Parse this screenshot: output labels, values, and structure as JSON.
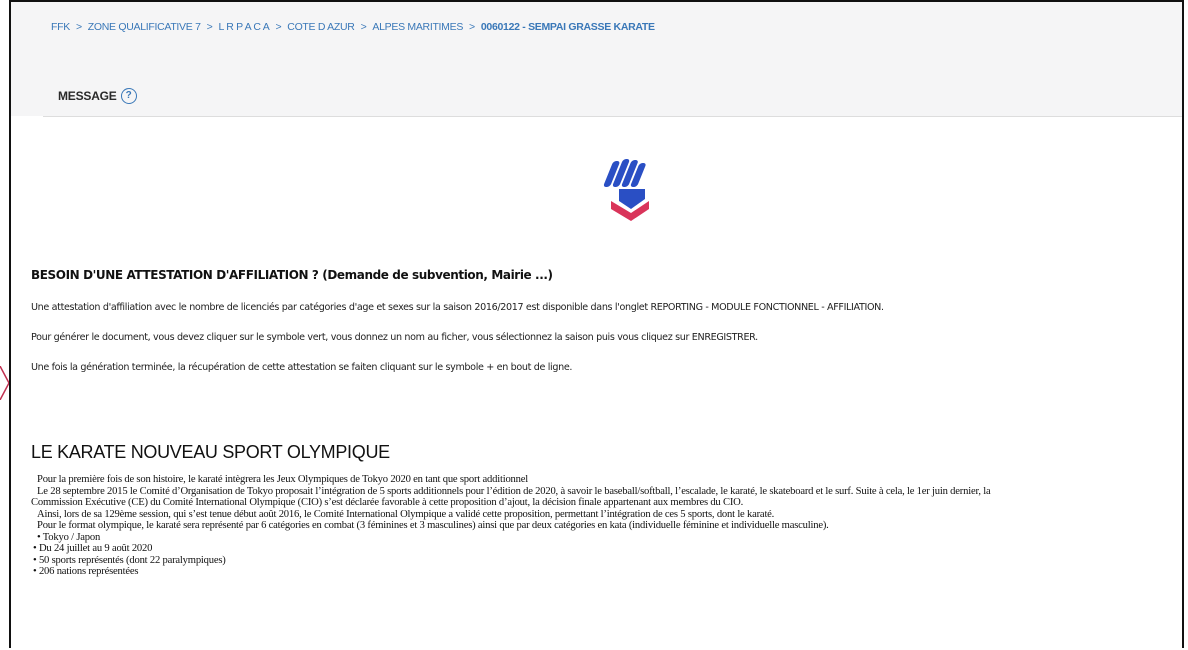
{
  "breadcrumb": {
    "items": [
      "FFK",
      "ZONE QUALIFICATIVE 7",
      "L R P A C A",
      "COTE D AZUR",
      "ALPES MARITIMES"
    ],
    "current": "0060122 - SEMPAI GRASSE KARATE",
    "separator": ">"
  },
  "message": {
    "title": "MESSAGE",
    "help_glyph": "?"
  },
  "logo": {
    "icon": "ffk-fist-logo-icon",
    "colors": {
      "blue": "#2a4fc4",
      "red": "#d9345a"
    }
  },
  "affiliation": {
    "title": "BESOIN D'UNE ATTESTATION D'AFFILIATION ? (Demande de subvention, Mairie ...)",
    "paragraphs": [
      "Une attestation d'affiliation avec le nombre de licenciés par catégories d'age et sexes sur la saison 2016/2017 est disponible dans l'onglet REPORTING - MODULE FONCTIONNEL - AFFILIATION.",
      "Pour générer le document, vous devez cliquer sur le symbole vert, vous donnez un nom au ficher, vous sélectionnez la saison puis vous cliquez sur ENREGISTRER.",
      "Une fois la génération terminée, la récupération de cette attestation se faiten cliquant sur le symbole + en bout de ligne."
    ]
  },
  "olympic": {
    "title": "LE KARATE NOUVEAU SPORT OLYMPIQUE",
    "lines": [
      "Pour la première fois de son histoire, le karaté intègrera les Jeux Olympiques de Tokyo 2020 en tant que sport additionnel",
      "Le 28 septembre 2015 le Comité d’Organisation de Tokyo proposait l’intégration de 5 sports additionnels pour l’édition de 2020, à savoir le baseball/softball, l’escalade, le karaté, le skateboard et le surf. Suite à cela, le 1er juin dernier, la",
      "Commission Exécutive (CE) du Comité International Olympique (CIO) s’est déclarée favorable à cette proposition d’ajout, la décision finale appartenant aux membres du CIO.",
      "Ainsi, lors de sa 129ème session, qui s’est tenue début août 2016, le Comité International Olympique a validé cette proposition, permettant l’intégration de ces 5 sports, dont le karaté.",
      "Pour le format olympique, le karaté sera représenté par 6 catégories en combat (3 féminines et 3 masculines) ainsi que par deux catégories en kata (individuelle féminine et individuelle masculine).",
      "• Tokyo / Japon",
      "• Du 24 juillet au 9 août 2020",
      "• 50 sports représentés (dont 22 paralympiques)",
      "• 206 nations représentées"
    ]
  }
}
